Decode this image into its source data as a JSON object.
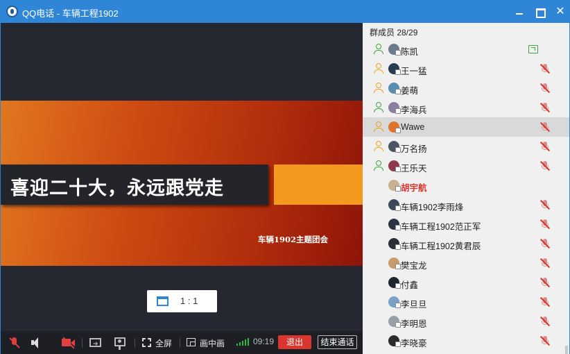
{
  "window": {
    "title": "QQ电话 - 车辆工程1902",
    "accent_color": "#2f86d6"
  },
  "slide": {
    "headline": "喜迎二十大，永远跟党走",
    "subtitle": "车辆1902主题团会"
  },
  "view": {
    "ratio_label": "1 : 1"
  },
  "toolbar": {
    "fullscreen_label": "全屏",
    "pip_label": "画中画",
    "timer": "09:19",
    "exit_label": "退出",
    "end_call_label": "结束通话",
    "exit_color": "#d9362f"
  },
  "panel": {
    "member_count": "群成员 28/29",
    "members": [
      {
        "name": "陈凯",
        "in_call": true,
        "status": "screen-sharing",
        "avatar_color": "#6a7b8e"
      },
      {
        "name": "王一猛",
        "in_call": true,
        "status": "muted",
        "avatar_color": "#2a3c52"
      },
      {
        "name": "姜萌",
        "in_call": true,
        "status": "muted",
        "avatar_color": "#5a8bb0"
      },
      {
        "name": "李海兵",
        "in_call": true,
        "status": "muted",
        "avatar_color": "#8a7fa0"
      },
      {
        "name": "Wawe",
        "in_call": true,
        "status": "muted",
        "avatar_color": "#e0742a",
        "selected": true
      },
      {
        "name": "万名扬",
        "in_call": true,
        "status": "muted",
        "avatar_color": "#4a5560"
      },
      {
        "name": "王乐天",
        "in_call": true,
        "status": "muted",
        "avatar_color": "#8c3a4a"
      },
      {
        "name": "胡宇航",
        "in_call": false,
        "status": "none",
        "avatar_color": "#c8b090",
        "highlight": true
      },
      {
        "name": "车辆1902李雨烽",
        "in_call": false,
        "status": "muted",
        "avatar_color": "#3c4a5c"
      },
      {
        "name": "车辆工程1902范正军",
        "in_call": false,
        "status": "muted",
        "avatar_color": "#2c3444"
      },
      {
        "name": "车辆工程1902黄君辰",
        "in_call": false,
        "status": "muted",
        "avatar_color": "#2a2f38"
      },
      {
        "name": "樊宝龙",
        "in_call": false,
        "status": "muted",
        "avatar_color": "#c99a6a"
      },
      {
        "name": "付鑫",
        "in_call": false,
        "status": "muted",
        "avatar_color": "#1e2430"
      },
      {
        "name": "李旦旦",
        "in_call": false,
        "status": "muted",
        "avatar_color": "#7aa0c8"
      },
      {
        "name": "李明恩",
        "in_call": false,
        "status": "muted",
        "avatar_color": "#9aa0a8"
      },
      {
        "name": "李晓豪",
        "in_call": false,
        "status": "muted",
        "avatar_color": "#2c2a2a"
      }
    ]
  }
}
